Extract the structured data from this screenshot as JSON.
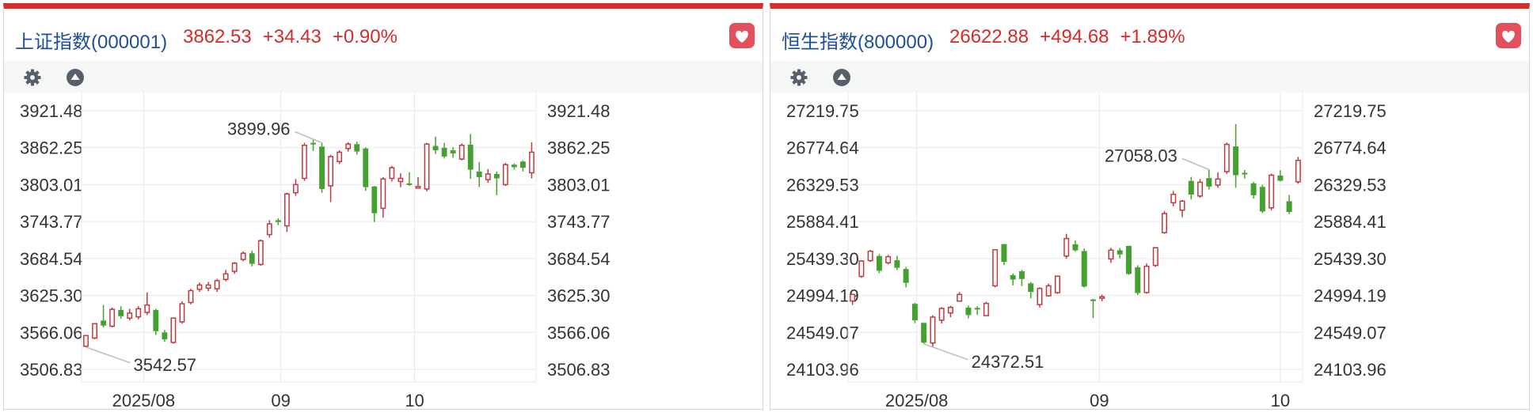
{
  "panels": [
    {
      "name": "上证指数(000001)",
      "price": "3862.53",
      "change": "+34.43",
      "pct": "+0.90%",
      "chart_data": {
        "type": "candlestick",
        "y_ticks": [
          "3921.48",
          "3862.25",
          "3803.01",
          "3743.77",
          "3684.54",
          "3625.30",
          "3566.06",
          "3506.83"
        ],
        "ylim": [
          3506.83,
          3921.48
        ],
        "x_ticks": [
          {
            "label": "2025/08",
            "index": 7.1
          },
          {
            "label": "09",
            "index": 22.8
          },
          {
            "label": "10",
            "index": 38.1
          }
        ],
        "high_label": "3899.96",
        "high_index": 27,
        "low_label": "3542.57",
        "low_index": 0,
        "ohlc": [
          [
            3544,
            3561,
            3542.57,
            3560
          ],
          [
            3557,
            3580,
            3555,
            3577
          ],
          [
            3585,
            3577,
            3574,
            3610
          ],
          [
            3576,
            3603,
            3574,
            3606
          ],
          [
            3602,
            3592,
            3588,
            3608
          ],
          [
            3589,
            3597,
            3585,
            3604
          ],
          [
            3591,
            3604,
            3587,
            3608
          ],
          [
            3598,
            3610,
            3594,
            3630
          ],
          [
            3602,
            3568,
            3562,
            3604
          ],
          [
            3566,
            3555,
            3551,
            3570
          ],
          [
            3550,
            3589,
            3548,
            3590
          ],
          [
            3583,
            3612,
            3580,
            3616
          ],
          [
            3614,
            3633,
            3611,
            3636
          ],
          [
            3635,
            3642,
            3631,
            3646
          ],
          [
            3637,
            3642,
            3632,
            3647
          ],
          [
            3636,
            3649,
            3631,
            3652
          ],
          [
            3651,
            3660,
            3648,
            3666
          ],
          [
            3664,
            3677,
            3660,
            3679
          ],
          [
            3683,
            3693,
            3680,
            3696
          ],
          [
            3693,
            3676,
            3672,
            3697
          ],
          [
            3675,
            3713,
            3673,
            3715
          ],
          [
            3723,
            3740,
            3718,
            3746
          ],
          [
            3746,
            3743,
            3738,
            3749
          ],
          [
            3737,
            3788,
            3727,
            3790
          ],
          [
            3790,
            3803,
            3785,
            3812
          ],
          [
            3813,
            3866,
            3809,
            3870
          ],
          [
            3870,
            3868,
            3857,
            3875
          ],
          [
            3864,
            3796,
            3790,
            3870
          ],
          [
            3801,
            3848,
            3775,
            3851
          ],
          [
            3840,
            3855,
            3836,
            3858
          ],
          [
            3861,
            3868,
            3856,
            3871
          ],
          [
            3868,
            3856,
            3851,
            3872
          ],
          [
            3861,
            3799,
            3793,
            3863
          ],
          [
            3800,
            3757,
            3743,
            3801
          ],
          [
            3765,
            3812,
            3750,
            3815
          ],
          [
            3813,
            3830,
            3808,
            3833
          ],
          [
            3808,
            3813,
            3799,
            3821
          ],
          [
            3805,
            3803,
            3801,
            3823
          ],
          [
            3800,
            3800,
            3798,
            3815
          ],
          [
            3796,
            3868,
            3792,
            3870
          ],
          [
            3865,
            3858,
            3852,
            3880
          ],
          [
            3862,
            3848,
            3845,
            3870
          ],
          [
            3858,
            3853,
            3846,
            3863
          ],
          [
            3844,
            3866,
            3842,
            3869
          ],
          [
            3867,
            3827,
            3812,
            3884
          ],
          [
            3824,
            3815,
            3799,
            3839
          ],
          [
            3811,
            3820,
            3806,
            3828
          ],
          [
            3820,
            3813,
            3786,
            3824
          ],
          [
            3803,
            3835,
            3801,
            3838
          ],
          [
            3835,
            3831,
            3827,
            3837
          ],
          [
            3840,
            3830,
            3824,
            3842
          ],
          [
            3822,
            3855,
            3813,
            3871
          ]
        ]
      }
    },
    {
      "name": "恒生指数(800000)",
      "price": "26622.88",
      "change": "+494.68",
      "pct": "+1.89%",
      "chart_data": {
        "type": "candlestick",
        "y_ticks": [
          "27219.75",
          "26774.64",
          "26329.53",
          "25884.41",
          "25439.30",
          "24994.19",
          "24549.07",
          "24103.96"
        ],
        "ylim": [
          24103.96,
          27219.75
        ],
        "x_ticks": [
          {
            "label": "2025/08",
            "index": 7.7
          },
          {
            "label": "09",
            "index": 28.2
          },
          {
            "label": "10",
            "index": 48.5
          }
        ],
        "high_label": "27058.03",
        "high_index": 40,
        "low_label": "24372.51",
        "low_index": 8,
        "ohlc": [
          [
            24928,
            25006,
            24880,
            25012
          ],
          [
            25224,
            25409,
            25206,
            25420
          ],
          [
            25414,
            25527,
            25398,
            25543
          ],
          [
            25470,
            25291,
            25262,
            25493
          ],
          [
            25388,
            25461,
            25367,
            25483
          ],
          [
            25419,
            25328,
            25300,
            25472
          ],
          [
            25313,
            25146,
            25091,
            25336
          ],
          [
            24893,
            24695,
            24660,
            24906
          ],
          [
            24664,
            24425,
            24411,
            24668
          ],
          [
            24421,
            24733,
            24372.51,
            24755
          ],
          [
            24696,
            24838,
            24656,
            24852
          ],
          [
            24784,
            24850,
            24732,
            24870
          ],
          [
            24926,
            25006,
            24920,
            25035
          ],
          [
            24848,
            24758,
            24718,
            24874
          ],
          [
            24844,
            24826,
            24760,
            24865
          ],
          [
            24751,
            24898,
            24748,
            24919
          ],
          [
            25110,
            25545,
            25091,
            25548
          ],
          [
            25613,
            25398,
            25360,
            25615
          ],
          [
            25238,
            25186,
            25116,
            25259
          ],
          [
            25286,
            25192,
            25108,
            25302
          ],
          [
            25140,
            25036,
            24960,
            25154
          ],
          [
            24884,
            25079,
            24849,
            25092
          ],
          [
            24990,
            25110,
            24980,
            25136
          ],
          [
            25028,
            25226,
            25012,
            25233
          ],
          [
            25469,
            25680,
            25437,
            25736
          ],
          [
            25611,
            25537,
            25523,
            25659
          ],
          [
            25530,
            25101,
            25088,
            25561
          ],
          [
            24946,
            24941,
            24721,
            24953
          ],
          [
            24962,
            24979,
            24925,
            25004
          ],
          [
            25434,
            25540,
            25386,
            25569
          ],
          [
            25538,
            25488,
            25442,
            25565
          ],
          [
            25591,
            25253,
            25240,
            25595
          ],
          [
            25334,
            25023,
            25000,
            25358
          ],
          [
            25030,
            25346,
            25016,
            25380
          ],
          [
            25356,
            25569,
            25338,
            25576
          ],
          [
            25751,
            25981,
            25737,
            26011
          ],
          [
            26111,
            26212,
            26070,
            26253
          ],
          [
            26021,
            26131,
            25937,
            26145
          ],
          [
            26374,
            26209,
            26151,
            26423
          ],
          [
            26192,
            26358,
            26170,
            26396
          ],
          [
            26408,
            26306,
            26270,
            26511
          ],
          [
            26324,
            26397,
            26290,
            26478
          ],
          [
            26486,
            26814,
            26457,
            26837
          ],
          [
            26790,
            26443,
            26291,
            27058.03
          ],
          [
            26472,
            26452,
            26403,
            26506
          ],
          [
            26345,
            26201,
            26161,
            26363
          ],
          [
            26302,
            26006,
            25985,
            26326
          ],
          [
            26050,
            26443,
            26020,
            26463
          ],
          [
            26439,
            26376,
            26368,
            26502
          ],
          [
            26130,
            26000,
            25974,
            26205
          ],
          [
            26364,
            26622,
            26340,
            26663
          ]
        ]
      }
    }
  ],
  "colors": {
    "up": "#c3393f",
    "down": "#45a12f",
    "accent": "#d42b2b",
    "name": "#1d4f9a",
    "axis": "#333333",
    "grid": "#e8e8e8"
  },
  "icons": [
    "gear-icon",
    "arrow-up-icon",
    "heart-icon"
  ]
}
